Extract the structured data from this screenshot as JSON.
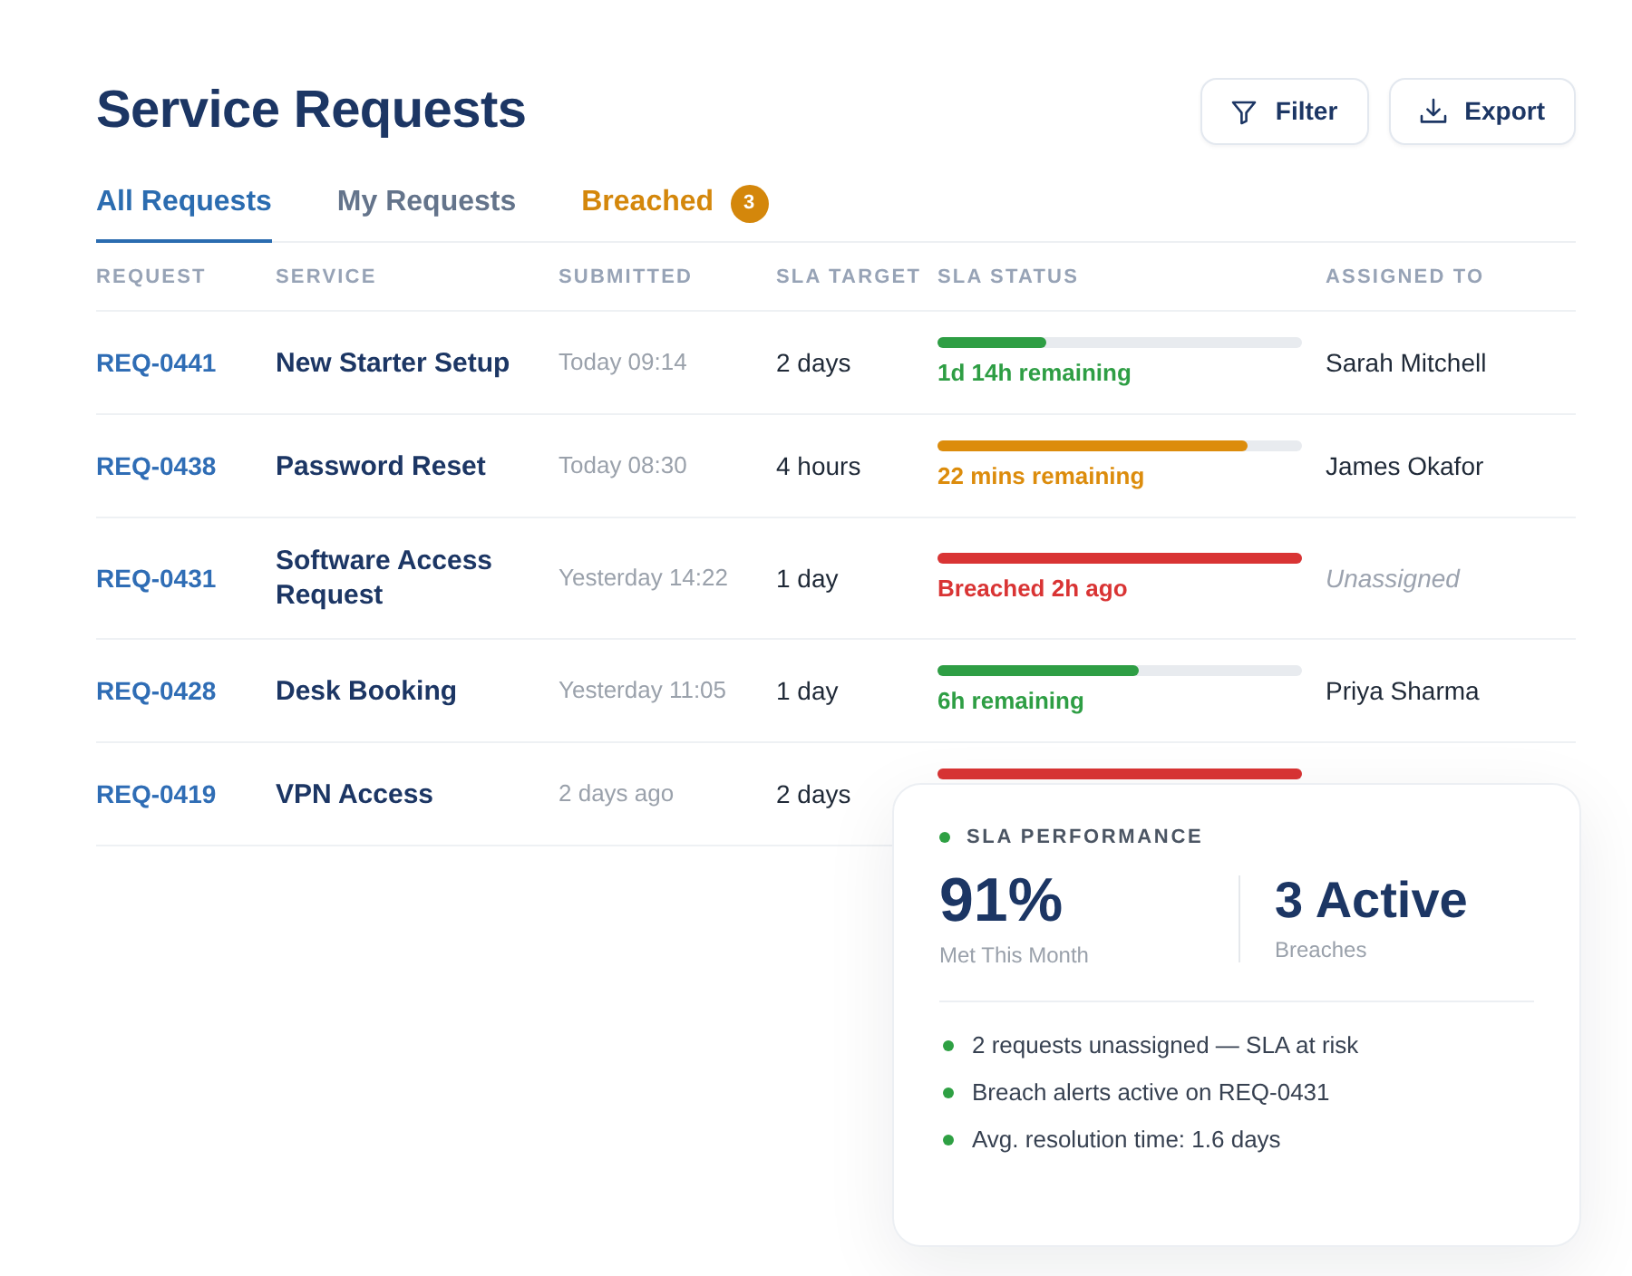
{
  "header": {
    "title": "Service Requests",
    "actions": [
      {
        "kind": "filter",
        "label": "Filter"
      },
      {
        "kind": "export",
        "label": "Export"
      }
    ]
  },
  "tabs": [
    {
      "label": "All Requests",
      "selected": true,
      "kind": "normal"
    },
    {
      "label": "My Requests",
      "selected": false,
      "kind": "normal"
    },
    {
      "label": "Breached",
      "selected": false,
      "kind": "alert",
      "badge": "3"
    }
  ],
  "table": {
    "columns": [
      "REQUEST",
      "SERVICE",
      "SUBMITTED",
      "SLA TARGET",
      "SLA STATUS",
      "ASSIGNED TO"
    ],
    "rows": [
      {
        "request": "REQ-0441",
        "service": "New Starter Setup",
        "submitted": "Today 09:14",
        "sla_target": "2 days",
        "sla": {
          "color": "#2e9e44",
          "level": 0.3,
          "text": "1d 14h remaining"
        },
        "assigned_to": "Sarah Mitchell",
        "unassigned": false
      },
      {
        "request": "REQ-0438",
        "service": "Password Reset",
        "submitted": "Today 08:30",
        "sla_target": "4 hours",
        "sla": {
          "color": "#dc8c0c",
          "level": 0.85,
          "text": "22 mins remaining"
        },
        "assigned_to": "James Okafor",
        "unassigned": false
      },
      {
        "request": "REQ-0431",
        "service": "Software Access Request",
        "submitted": "Yesterday 14:22",
        "sla_target": "1 day",
        "sla": {
          "color": "#d93434",
          "level": 1,
          "text": "Breached 2h ago"
        },
        "assigned_to": "Unassigned",
        "unassigned": true
      },
      {
        "request": "REQ-0428",
        "service": "Desk Booking",
        "submitted": "Yesterday 11:05",
        "sla_target": "1 day",
        "sla": {
          "color": "#2e9e44",
          "level": 0.55,
          "text": "6h remaining"
        },
        "assigned_to": "Priya Sharma",
        "unassigned": false
      },
      {
        "request": "REQ-0419",
        "service": "VPN Access",
        "submitted": "2 days ago",
        "sla_target": "2 days",
        "sla": {
          "color": "#d93434",
          "level": 1
        }
      }
    ]
  },
  "sla_performance": {
    "title": "SLA PERFORMANCE",
    "stats": [
      {
        "value": "91%",
        "label": "Met This Month"
      },
      {
        "value": "3 Active",
        "label": "Breaches"
      }
    ],
    "notes": [
      "2 requests unassigned — SLA at risk",
      "Breach alerts active on REQ-0431",
      "Avg. resolution time: 1.6 days"
    ]
  }
}
